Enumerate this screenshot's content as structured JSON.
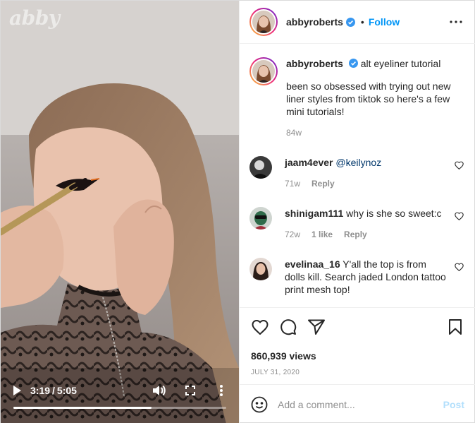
{
  "media": {
    "watermark": "abby",
    "current_time": "3:19",
    "time_separator": "/",
    "duration": "5:05",
    "progress": 0.65
  },
  "header": {
    "username": "abbyroberts",
    "separator": "•",
    "follow_label": "Follow"
  },
  "caption": {
    "username": "abbyroberts",
    "title": "alt eyeliner tutorial",
    "text": "been so obsessed with trying out new liner styles from tiktok so here's a few mini tutorials!",
    "age": "84w"
  },
  "comments": [
    {
      "username": "jaam4ever",
      "text": "@keilynoz",
      "age": "71w",
      "likes": "",
      "reply": "Reply"
    },
    {
      "username": "shinigam111",
      "text": "why is she so sweet:c",
      "age": "72w",
      "likes": "1 like",
      "reply": "Reply"
    },
    {
      "username": "evelinaa_16",
      "text": "Y'all the top is from dolls kill. Search jaded London tattoo print mesh top!",
      "age": "",
      "likes": "",
      "reply": ""
    }
  ],
  "stats": {
    "views": "860,939 views",
    "date": "JULY 31, 2020"
  },
  "add_comment": {
    "placeholder": "Add a comment...",
    "post_label": "Post"
  },
  "colors": {
    "accent": "#0095f6",
    "post_disabled": "#b2dffc"
  }
}
